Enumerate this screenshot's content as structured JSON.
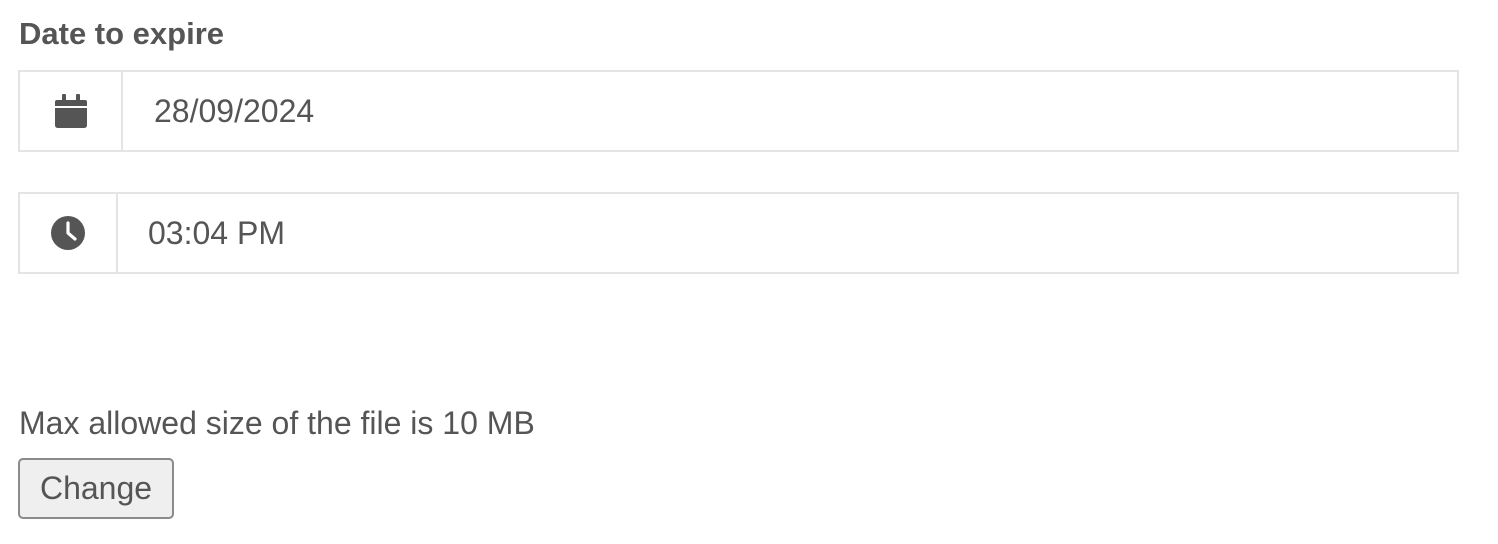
{
  "expiry": {
    "label": "Date to expire",
    "date": {
      "icon": "calendar-icon",
      "value": "28/09/2024"
    },
    "time": {
      "icon": "clock-icon",
      "value": "03:04 PM"
    }
  },
  "upload": {
    "hint": "Max allowed size of the file is 10 MB",
    "change_label": "Change"
  },
  "colors": {
    "text": "#555555",
    "border": "#e4e4e4",
    "button_bg": "#efefef"
  }
}
